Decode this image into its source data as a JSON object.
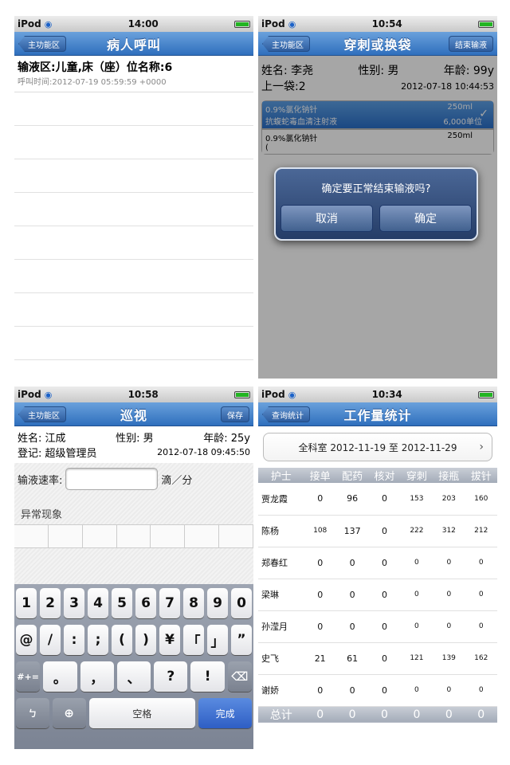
{
  "screen1": {
    "status": {
      "device": "iPod",
      "time": "14:00"
    },
    "nav": {
      "back": "主功能区",
      "title": "病人呼叫"
    },
    "call": {
      "title": "输液区:儿童,床（座）位名称:6",
      "time": "呼叫时间:2012-07-19 05:59:59 +0000"
    }
  },
  "screen2": {
    "status": {
      "device": "iPod",
      "time": "10:54"
    },
    "nav": {
      "back": "主功能区",
      "title": "穿刺或换袋",
      "right": "结束输液"
    },
    "patient": {
      "name": "姓名: 李尧",
      "gender": "性别: 男",
      "age": "年龄: 99y",
      "last_bag": "上一袋:2",
      "datetime": "2012-07-18 10:44:53"
    },
    "meds": [
      {
        "drug1": "0.9%氯化钠针",
        "dose1": "250ml",
        "drug2": "抗蝮蛇毒血清注射液",
        "dose2": "6,000单位"
      },
      {
        "drug1": "0.9%氯化钠针",
        "dose1": "250ml",
        "drug2": "(",
        "dose2": ""
      }
    ],
    "dialog": {
      "message": "确定要正常结束输液吗?",
      "cancel": "取消",
      "ok": "确定"
    }
  },
  "screen3": {
    "status": {
      "device": "iPod",
      "time": "10:58"
    },
    "nav": {
      "back": "主功能区",
      "title": "巡视",
      "right": "保存"
    },
    "patient": {
      "name": "姓名: 江成",
      "gender": "性别: 男",
      "age": "年龄: 25y",
      "recorder": "登记: 超级管理员",
      "datetime": "2012-07-18 09:45:50"
    },
    "rate": {
      "label": "输液速率:",
      "value": "",
      "unit": "滴／分"
    },
    "abnormal_label": "异常现象",
    "keyboard": {
      "row1": [
        "1",
        "2",
        "3",
        "4",
        "5",
        "6",
        "7",
        "8",
        "9",
        "0"
      ],
      "row2": [
        "@",
        "/",
        ":",
        ";",
        "(",
        ")",
        "¥",
        "「",
        "」",
        "”"
      ],
      "row3": [
        "#+=",
        "。",
        "，",
        "、",
        "?",
        "!",
        "⌫"
      ],
      "row4": [
        "ㄅ",
        "⊕",
        "空格",
        "完成"
      ]
    }
  },
  "screen4": {
    "status": {
      "device": "iPod",
      "time": "10:34"
    },
    "nav": {
      "back": "查询统计",
      "title": "工作量统计"
    },
    "filter": "全科室 2012-11-19 至 2012-11-29",
    "table": {
      "headers": [
        "护士",
        "接单",
        "配药",
        "核对",
        "穿刺",
        "接瓶",
        "拔针"
      ],
      "rows": [
        [
          "贾龙霞",
          "0",
          "96",
          "0",
          "153",
          "203",
          "160"
        ],
        [
          "陈杨",
          "108",
          "137",
          "0",
          "222",
          "312",
          "212"
        ],
        [
          "郑春红",
          "0",
          "0",
          "0",
          "0",
          "0",
          "0"
        ],
        [
          "梁琳",
          "0",
          "0",
          "0",
          "0",
          "0",
          "0"
        ],
        [
          "孙滢月",
          "0",
          "0",
          "0",
          "0",
          "0",
          "0"
        ],
        [
          "史飞",
          "21",
          "61",
          "0",
          "121",
          "139",
          "162"
        ],
        [
          "谢娇",
          "0",
          "0",
          "0",
          "0",
          "0",
          "0"
        ]
      ],
      "total": [
        "总计",
        "0",
        "0",
        "0",
        "0",
        "0",
        "0"
      ]
    }
  }
}
